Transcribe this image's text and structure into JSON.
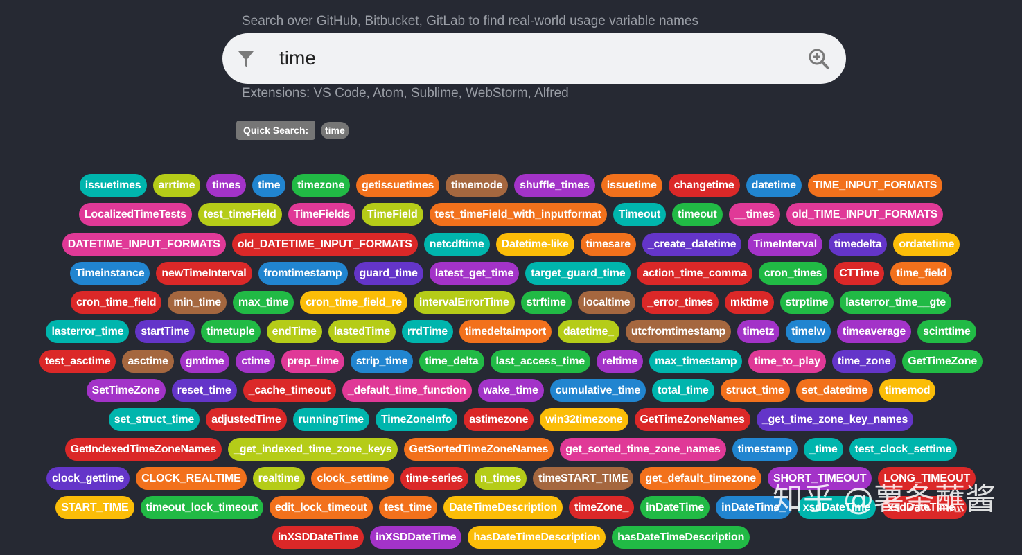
{
  "header": {
    "subtitle": "Search over GitHub, Bitbucket, GitLab to find real-world usage variable names",
    "extensions": "Extensions: VS Code, Atom, Sublime, WebStorm, Alfred"
  },
  "search": {
    "value": "time",
    "filter_icon": "filter-icon",
    "search_icon": "zoom-in-icon"
  },
  "quick_search": {
    "label": "Quick Search:",
    "tags": [
      "time"
    ]
  },
  "colors": {
    "background": "#262933",
    "teal": "#00b5ad",
    "olive": "#b5cc18",
    "purple": "#a333c8",
    "blue": "#2185d0",
    "green": "#21ba45",
    "orange": "#f2711c",
    "brown": "#a5673f",
    "red": "#db2828",
    "pink": "#e03997",
    "violet": "#6435c9",
    "yellow": "#fbbd08"
  },
  "watermark": "知乎 @薯条蘸酱",
  "results": [
    [
      [
        "issuetimes",
        "teal"
      ],
      [
        "arrtime",
        "olive"
      ],
      [
        "times",
        "purple"
      ],
      [
        "time",
        "blue"
      ],
      [
        "timezone",
        "green"
      ],
      [
        "getissuetimes",
        "orange"
      ],
      [
        "timemode",
        "brown"
      ],
      [
        "shuffle_times",
        "purple"
      ],
      [
        "issuetime",
        "orange"
      ],
      [
        "changetime",
        "red"
      ],
      [
        "datetime",
        "blue"
      ],
      [
        "TIME_INPUT_FORMATS",
        "orange"
      ]
    ],
    [
      [
        "LocalizedTimeTests",
        "pink"
      ],
      [
        "test_timeField",
        "olive"
      ],
      [
        "TimeFields",
        "pink"
      ],
      [
        "TimeField",
        "olive"
      ],
      [
        "test_timeField_with_inputformat",
        "orange"
      ],
      [
        "Timeout",
        "teal"
      ],
      [
        "timeout",
        "green"
      ],
      [
        "__times",
        "pink"
      ],
      [
        "old_TIME_INPUT_FORMATS",
        "pink"
      ]
    ],
    [
      [
        "DATETIME_INPUT_FORMATS",
        "pink"
      ],
      [
        "old_DATETIME_INPUT_FORMATS",
        "red"
      ],
      [
        "netcdftime",
        "teal"
      ],
      [
        "Datetime-like",
        "yellow"
      ],
      [
        "timesare",
        "orange"
      ],
      [
        "_create_datetime",
        "violet"
      ],
      [
        "TimeInterval",
        "purple"
      ],
      [
        "timedelta",
        "violet"
      ],
      [
        "ordatetime",
        "yellow"
      ]
    ],
    [
      [
        "Timeinstance",
        "blue"
      ],
      [
        "newTimeInterval",
        "red"
      ],
      [
        "fromtimestamp",
        "blue"
      ],
      [
        "guard_time",
        "violet"
      ],
      [
        "latest_get_time",
        "purple"
      ],
      [
        "target_guard_time",
        "teal"
      ],
      [
        "action_time_comma",
        "red"
      ],
      [
        "cron_times",
        "green"
      ],
      [
        "CTTime",
        "red"
      ],
      [
        "time_field",
        "orange"
      ]
    ],
    [
      [
        "cron_time_field",
        "red"
      ],
      [
        "min_time",
        "brown"
      ],
      [
        "max_time",
        "green"
      ],
      [
        "cron_time_field_re",
        "yellow"
      ],
      [
        "intervalErrorTime",
        "olive"
      ],
      [
        "strftime",
        "green"
      ],
      [
        "localtime",
        "brown"
      ],
      [
        "_error_times",
        "red"
      ],
      [
        "mktime",
        "red"
      ],
      [
        "strptime",
        "green"
      ],
      [
        "lasterror_time__gte",
        "green"
      ]
    ],
    [
      [
        "lasterror_time",
        "teal"
      ],
      [
        "startTime",
        "violet"
      ],
      [
        "timetuple",
        "green"
      ],
      [
        "endTime",
        "olive"
      ],
      [
        "lastedTime",
        "olive"
      ],
      [
        "rrdTime",
        "teal"
      ],
      [
        "timedeltaimport",
        "orange"
      ],
      [
        "datetime_",
        "olive"
      ],
      [
        "utcfromtimestamp",
        "brown"
      ],
      [
        "timetz",
        "purple"
      ],
      [
        "timelw",
        "blue"
      ],
      [
        "timeaverage",
        "purple"
      ],
      [
        "scinttime",
        "green"
      ]
    ],
    [
      [
        "test_asctime",
        "red"
      ],
      [
        "asctime",
        "brown"
      ],
      [
        "gmtime",
        "purple"
      ],
      [
        "ctime",
        "purple"
      ],
      [
        "prep_time",
        "pink"
      ],
      [
        "strip_time",
        "blue"
      ],
      [
        "time_delta",
        "green"
      ],
      [
        "last_access_time",
        "green"
      ],
      [
        "reltime",
        "purple"
      ],
      [
        "max_timestamp",
        "teal"
      ],
      [
        "time_to_play",
        "pink"
      ],
      [
        "time_zone",
        "violet"
      ],
      [
        "GetTimeZone",
        "green"
      ]
    ],
    [
      [
        "SetTimeZone",
        "purple"
      ],
      [
        "reset_time",
        "violet"
      ],
      [
        "_cache_timeout",
        "red"
      ],
      [
        "_default_time_function",
        "pink"
      ],
      [
        "wake_time",
        "purple"
      ],
      [
        "cumulative_time",
        "blue"
      ],
      [
        "total_time",
        "teal"
      ],
      [
        "struct_time",
        "orange"
      ],
      [
        "set_datetime",
        "orange"
      ],
      [
        "timemod",
        "yellow"
      ]
    ],
    [
      [
        "set_struct_time",
        "teal"
      ],
      [
        "adjustedTime",
        "red"
      ],
      [
        "runningTime",
        "teal"
      ],
      [
        "TimeZoneInfo",
        "teal"
      ],
      [
        "astimezone",
        "red"
      ],
      [
        "win32timezone",
        "yellow"
      ],
      [
        "GetTimeZoneNames",
        "red"
      ],
      [
        "_get_time_zone_key_names",
        "violet"
      ]
    ],
    [
      [
        "GetIndexedTimeZoneNames",
        "red"
      ],
      [
        "_get_indexed_time_zone_keys",
        "olive"
      ],
      [
        "GetSortedTimeZoneNames",
        "orange"
      ],
      [
        "get_sorted_time_zone_names",
        "pink"
      ],
      [
        "timestamp",
        "blue"
      ],
      [
        "_time",
        "teal"
      ],
      [
        "test_clock_settime",
        "teal"
      ]
    ],
    [
      [
        "clock_gettime",
        "violet"
      ],
      [
        "CLOCK_REALTIME",
        "orange"
      ],
      [
        "realtime",
        "olive"
      ],
      [
        "clock_settime",
        "orange"
      ],
      [
        "time-series",
        "red"
      ],
      [
        "n_times",
        "olive"
      ],
      [
        "timeSTART_TIME",
        "brown"
      ],
      [
        "get_default_timezone",
        "orange"
      ],
      [
        "SHORT_TIMEOUT",
        "purple"
      ],
      [
        "LONG_TIMEOUT",
        "red"
      ]
    ],
    [
      [
        "START_TIME",
        "yellow"
      ],
      [
        "timeout_lock_timeout",
        "green"
      ],
      [
        "edit_lock_timeout",
        "orange"
      ],
      [
        "test_time",
        "orange"
      ],
      [
        "DateTimeDescription",
        "yellow"
      ],
      [
        "timeZone_",
        "red"
      ],
      [
        "inDateTime",
        "green"
      ],
      [
        "inDateTime_",
        "blue"
      ],
      [
        "xsdDateTime",
        "teal"
      ],
      [
        "xsdDateTime_",
        "red"
      ]
    ],
    [
      [
        "inXSDDateTime",
        "red"
      ],
      [
        "inXSDDateTime",
        "purple"
      ],
      [
        "hasDateTimeDescription",
        "yellow"
      ],
      [
        "hasDateTimeDescription",
        "green"
      ]
    ]
  ]
}
